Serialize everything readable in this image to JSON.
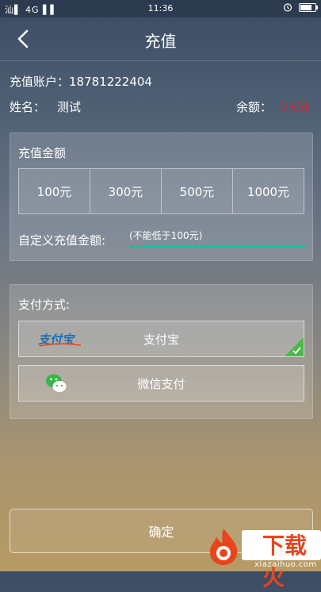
{
  "status_bar": {
    "signal_text": "汕▌ 4G ▌▌",
    "time": "11:36"
  },
  "header": {
    "title": "充值"
  },
  "account": {
    "account_label": "充值账户：18781222404",
    "name_label": "姓名：",
    "name_value": "测试",
    "balance_label": "余额：",
    "balance_value": "0.0元"
  },
  "recharge": {
    "title": "充值金额",
    "amounts": [
      "100元",
      "300元",
      "500元",
      "1000元"
    ],
    "custom_label": "自定义充值金额:",
    "custom_placeholder": "(不能低于100元)"
  },
  "payment": {
    "title": "支付方式:",
    "options": [
      {
        "label": "支付宝",
        "logo_text": "支付宝",
        "selected": true
      },
      {
        "label": "微信支付",
        "selected": false
      }
    ]
  },
  "confirm_label": "确定",
  "watermark": {
    "text": "下载火",
    "site": "xiazaihuo.com"
  },
  "colors": {
    "balance": "#e8202a",
    "input_underline": "#1fb8a6",
    "check": "#4cb848",
    "watermark": "#e8451c"
  }
}
